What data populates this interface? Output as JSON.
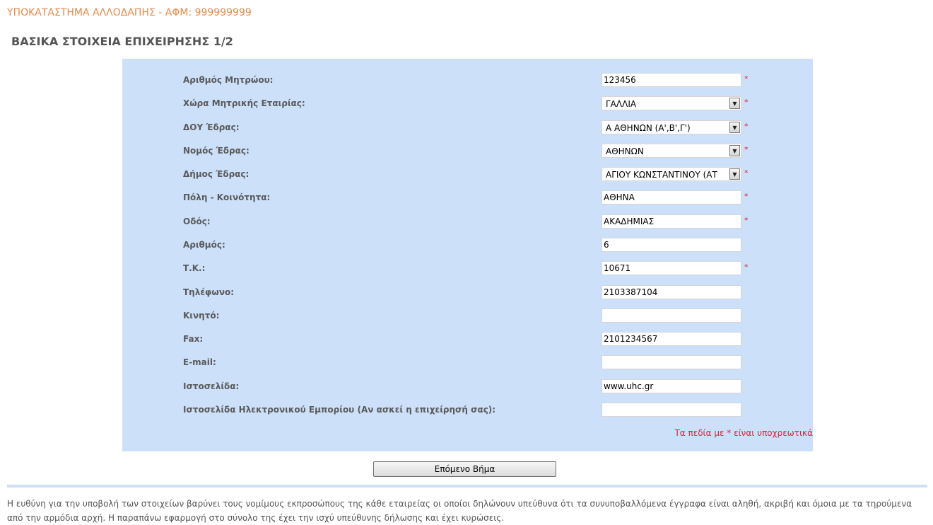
{
  "header": {
    "company_line": "ΥΠΟΚΑΤΑΣΤΗΜΑ ΑΛΛΟΔΑΠΗΣ - ΑΦΜ: 999999999",
    "page_title": "ΒΑΣΙΚΑ ΣΤΟΙΧΕΙΑ ΕΠΙΧΕΙΡΗΣΗΣ 1/2"
  },
  "form": {
    "fields": [
      {
        "label": "Αριθμός Μητρώου:",
        "value": "123456"
      },
      {
        "label": "Χώρα Μητρικής Εταιρίας:",
        "value": "ΓΑΛΛΙΑ"
      },
      {
        "label": "ΔΟΥ Έδρας:",
        "value": "Α ΑΘΗΝΩΝ (Α',Β',Γ')"
      },
      {
        "label": "Νομός Έδρας:",
        "value": "ΑΘΗΝΩΝ"
      },
      {
        "label": "Δήμος Έδρας:",
        "value": "ΑΓΙΟΥ ΚΩΝΣΤΑΝΤΙΝΟΥ (ΑΤ"
      },
      {
        "label": "Πόλη - Κοινότητα:",
        "value": "ΑΘΗΝΑ"
      },
      {
        "label": "Οδός:",
        "value": "ΑΚΑΔΗΜΙΑΣ"
      },
      {
        "label": "Αριθμός:",
        "value": "6"
      },
      {
        "label": "Τ.Κ.:",
        "value": "10671"
      },
      {
        "label": "Τηλέφωνο:",
        "value": "2103387104"
      },
      {
        "label": "Κινητό:",
        "value": ""
      },
      {
        "label": "Fax:",
        "value": "2101234567"
      },
      {
        "label": "E-mail:",
        "value": ""
      },
      {
        "label": "Ιστοσελίδα:",
        "value": "www.uhc.gr"
      },
      {
        "label": "Ιστοσελίδα Ηλεκτρονικού Εμπορίου (Αν ασκεί η επιχείρησή σας):",
        "value": ""
      }
    ],
    "required_mark": "*",
    "required_note": "Τα πεδία με * είναι υποχρεωτικά"
  },
  "actions": {
    "next_label": "Επόμενο Βήμα"
  },
  "footer": {
    "disclaimer": "Η ευθύνη για την υποβολή των στοιχείων βαρύνει τους νομίμους εκπροσώπους της κάθε εταιρείας οι οποίοι δηλώνουν υπεύθυνα ότι τα συνυποβαλλόμενα έγγραφα είναι αληθή, ακριβή και όμοια με τα τηρούμενα από την αρμόδια αρχή. Η παραπάνω εφαρμογή στο σύνολο της έχει την ισχύ υπεύθυνης δήλωσης και έχει κυρώσεις."
  },
  "colors": {
    "panel_background": "#cce0fa",
    "header_accent": "#e88a4a",
    "required": "#e0203a"
  },
  "icons": {
    "select_arrow": "chevron-down-icon"
  }
}
